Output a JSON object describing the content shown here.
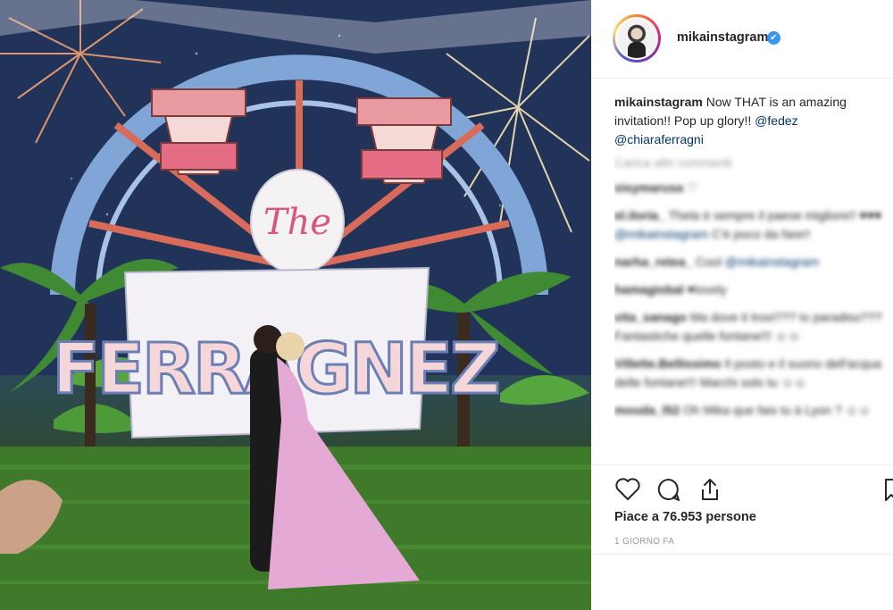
{
  "post": {
    "username": "mikainstagram",
    "verified_mark": "✔",
    "caption_username": "mikainstagram",
    "caption_text": " Now THAT is an amazing invitation!! Pop up glory!! ",
    "caption_mention_1": "@fedez",
    "caption_mention_2": "@chiaraferragni",
    "load_more": "Carica altri commenti",
    "likes": "Piace a 76.953 persone",
    "date": "1 GIORNO FA"
  },
  "comments": [
    {
      "user": "sisymarusa",
      "text": " ♡"
    },
    {
      "user": "el.iloria_",
      "text": " Thela è sempre il paese migliore!! ♥♥♥ ",
      "mention": "@mikainstagram",
      "tail": " C'è poco da fare!!"
    },
    {
      "user": "narha_retea_",
      "text": " Cool ",
      "mention": "@mikainstagram"
    },
    {
      "user": "hamagiobal",
      "text": " ♥lovely"
    },
    {
      "user": "vita_sanago",
      "text": " Ma dove ti trovi??? Io paradiso??? Fantastiche quelle fontane!!! ☺☺"
    },
    {
      "user": "Villette.Bellissimo",
      "text": " Il posto e il suono dell'acqua delle fontane!!! Marchi solo tu ☺☺"
    },
    {
      "user": "mouda_l52",
      "text": " Oh Mika que fais tu à Lyon ? ☺☺"
    }
  ],
  "photo": {
    "sign_line_1": "The",
    "sign_line_2": "FERRAGNEZ"
  },
  "icons": {
    "like": "heart-icon",
    "comment": "comment-icon",
    "share": "share-icon",
    "save": "bookmark-icon"
  },
  "colors": {
    "link": "#003569",
    "verified": "#3897f0",
    "muted": "#999999"
  }
}
